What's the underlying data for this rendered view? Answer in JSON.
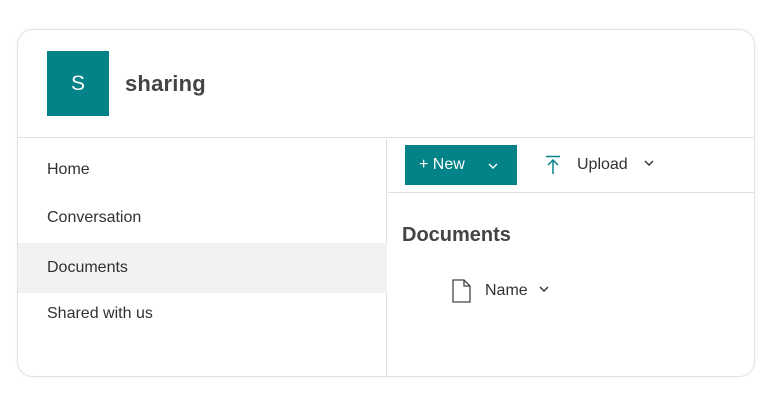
{
  "site": {
    "logo_letter": "S",
    "title": "sharing",
    "brand_color": "#038387"
  },
  "nav": {
    "items": [
      {
        "label": "Home",
        "selected": false
      },
      {
        "label": "Conversation",
        "selected": false
      },
      {
        "label": "Documents",
        "selected": true
      },
      {
        "label": "Shared with us",
        "selected": false
      }
    ]
  },
  "toolbar": {
    "new_label": "+ New",
    "upload_label": "Upload",
    "icons": {
      "new_dropdown": "chevron-down-icon",
      "upload": "upload-arrow-icon",
      "upload_dropdown": "chevron-down-icon"
    }
  },
  "main": {
    "heading": "Documents",
    "columns": [
      {
        "icon": "file-icon",
        "label": "Name",
        "sort_icon": "chevron-down-icon"
      }
    ]
  }
}
